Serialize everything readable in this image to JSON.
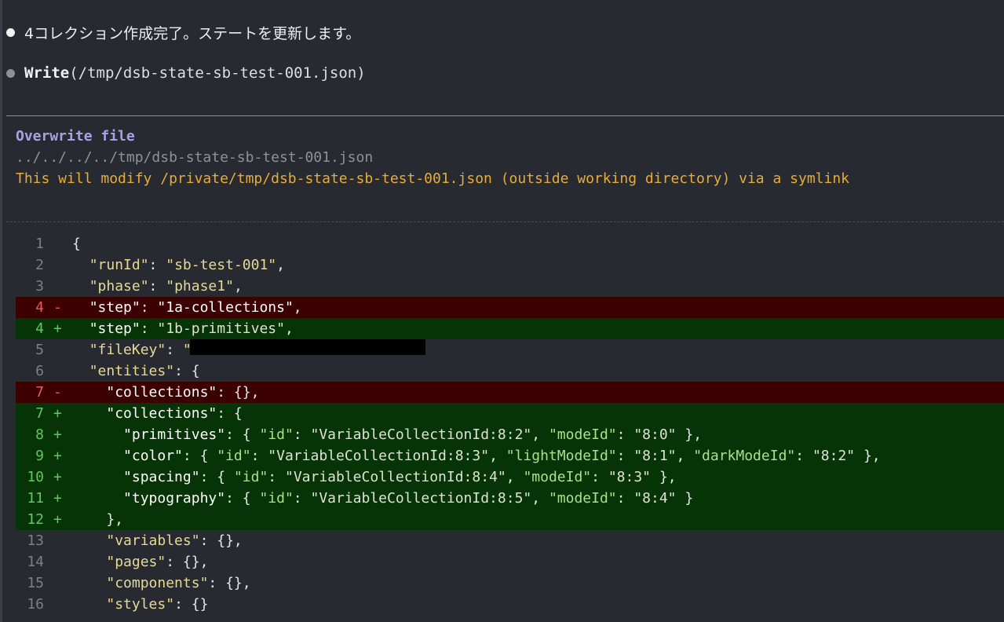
{
  "message": {
    "status_text": "4コレクション作成完了。ステートを更新します。"
  },
  "tool_call": {
    "name": "Write",
    "arg": "(/tmp/dsb-state-sb-test-001.json)"
  },
  "permission": {
    "title": "Overwrite file",
    "path": "../../../../tmp/dsb-state-sb-test-001.json",
    "warning": "This will modify /private/tmp/dsb-state-sb-test-001.json (outside working directory) via a symlink"
  },
  "diff": {
    "lines": [
      {
        "n": "1",
        "sign": "",
        "code": "{"
      },
      {
        "n": "2",
        "sign": "",
        "code": "  \"runId\": \"sb-test-001\","
      },
      {
        "n": "3",
        "sign": "",
        "code": "  \"phase\": \"phase1\","
      },
      {
        "n": "4",
        "sign": "-",
        "code": "  \"step\": \"1a-collections\","
      },
      {
        "n": "4",
        "sign": "+",
        "code": "  \"step\": \"1b-primitives\","
      },
      {
        "n": "5",
        "sign": "",
        "code": "  \"fileKey\": \""
      },
      {
        "n": "6",
        "sign": "",
        "code": "  \"entities\": {"
      },
      {
        "n": "7",
        "sign": "-",
        "code": "    \"collections\": {},"
      },
      {
        "n": "7",
        "sign": "+",
        "code": "    \"collections\": {"
      },
      {
        "n": "8",
        "sign": "+",
        "code": "      \"primitives\": { \"id\": \"VariableCollectionId:8:2\", \"modeId\": \"8:0\" },"
      },
      {
        "n": "9",
        "sign": "+",
        "code": "      \"color\": { \"id\": \"VariableCollectionId:8:3\", \"lightModeId\": \"8:1\", \"darkModeId\": \"8:2\" },"
      },
      {
        "n": "10",
        "sign": "+",
        "code": "      \"spacing\": { \"id\": \"VariableCollectionId:8:4\", \"modeId\": \"8:3\" },"
      },
      {
        "n": "11",
        "sign": "+",
        "code": "      \"typography\": { \"id\": \"VariableCollectionId:8:5\", \"modeId\": \"8:4\" }"
      },
      {
        "n": "12",
        "sign": "+",
        "code": "    },"
      },
      {
        "n": "13",
        "sign": "",
        "code": "    \"variables\": {},"
      },
      {
        "n": "14",
        "sign": "",
        "code": "    \"pages\": {},"
      },
      {
        "n": "15",
        "sign": "",
        "code": "    \"components\": {},"
      },
      {
        "n": "16",
        "sign": "",
        "code": "    \"styles\": {}"
      }
    ]
  }
}
